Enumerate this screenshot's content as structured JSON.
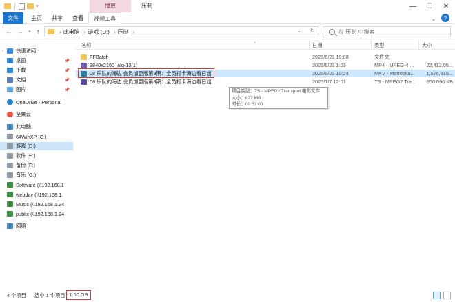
{
  "window": {
    "title": "压制",
    "context_tab": "播放",
    "controls": {
      "minimize": "—",
      "maximize": "☐",
      "close": "✕"
    }
  },
  "ribbon": {
    "tabs": [
      "文件",
      "主页",
      "共享",
      "查看",
      "视频工具"
    ],
    "active_tab": "文件"
  },
  "address": {
    "crumbs": [
      "此电脑",
      "游戏 (D:)",
      "压制"
    ],
    "search_placeholder": "在 压制 中搜索"
  },
  "sidebar": {
    "items": [
      {
        "label": "快速访问",
        "icon": "star-icon",
        "pin": false
      },
      {
        "label": "桌面",
        "icon": "desktop-icon",
        "pin": true
      },
      {
        "label": "下载",
        "icon": "download-icon",
        "pin": true
      },
      {
        "label": "文档",
        "icon": "document-icon",
        "pin": true
      },
      {
        "label": "图片",
        "icon": "picture-icon",
        "pin": true
      },
      {
        "label": "OneDrive - Personal",
        "icon": "onedrive-icon",
        "pin": false
      },
      {
        "label": "坚果云",
        "icon": "jianguoyun-icon",
        "pin": false
      },
      {
        "label": "此电脑",
        "icon": "pc-icon",
        "pin": false
      },
      {
        "label": "64WinXP  (C:)",
        "icon": "drive-icon",
        "pin": false
      },
      {
        "label": "游戏 (D:)",
        "icon": "drive-icon",
        "pin": false,
        "selected": true
      },
      {
        "label": "软件 (E:)",
        "icon": "drive-icon",
        "pin": false
      },
      {
        "label": "备份 (F:)",
        "icon": "drive-icon",
        "pin": false
      },
      {
        "label": "音乐 (G:)",
        "icon": "drive-icon",
        "pin": false
      },
      {
        "label": "Software (\\\\192.168.1",
        "icon": "network-drive-icon",
        "pin": false
      },
      {
        "label": "webdav (\\\\192.168.1.",
        "icon": "network-drive-icon",
        "pin": false
      },
      {
        "label": "Music (\\\\192.168.1.24",
        "icon": "network-drive-icon",
        "pin": false
      },
      {
        "label": "public (\\\\192.168.1.24",
        "icon": "network-drive-icon",
        "pin": false
      },
      {
        "label": "网络",
        "icon": "network-icon",
        "pin": false
      }
    ]
  },
  "columns": {
    "name": "名称",
    "date": "日期",
    "type": "类型",
    "size": "大小"
  },
  "files": [
    {
      "name": "FFBatch",
      "date": "2023/6/23 10:08",
      "type": "文件夹",
      "size": "",
      "icon": "folder-icon"
    },
    {
      "name": "3840x2160_alq-13(1)",
      "date": "2023/6/23 1:03",
      "type": "MP4 - MPEG-4 ...",
      "size": "22,412,05...",
      "icon": "mp4-icon"
    },
    {
      "name": "08 乐队的海边 会员加更版第8期：全员打卡海边看日出",
      "date": "2023/6/23 10:24",
      "type": "MKV - Matroska...",
      "size": "1,576,815...",
      "icon": "mkv-icon",
      "selected": true
    },
    {
      "name": "08 乐队的海边 会员加更版第8期：全员打卡海边看日出",
      "date": "2023/1/7 12:01",
      "type": "TS - MPEG2 Tra...",
      "size": "950,096 KB",
      "icon": "ts-icon"
    }
  ],
  "tooltip": {
    "line1": "项目类型：TS - MPEG2 Transport 电影文件",
    "line2": "大小：927 MB",
    "line3": "时长：00:52:00"
  },
  "status": {
    "count": "4 个项目",
    "selected": "选中 1 个项目",
    "size": "1.50 GB"
  },
  "colors": {
    "accent": "#1976d2",
    "highlight": "#e0342f",
    "selection": "#cce8ff",
    "context_tab": "#f3d9e2"
  }
}
